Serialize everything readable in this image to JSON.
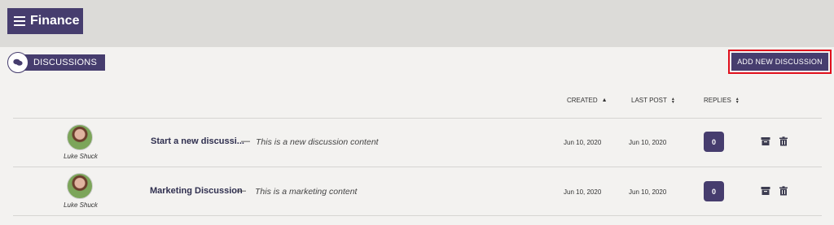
{
  "header": {
    "title": "Finance"
  },
  "section": {
    "title": "DISCUSSIONS",
    "add_button": "ADD NEW DISCUSSION"
  },
  "table": {
    "columns": [
      "CREATED",
      "LAST POST",
      "REPLIES"
    ],
    "rows": [
      {
        "author": "Luke Shuck",
        "title": "Start a new discussi...",
        "separator": "—",
        "excerpt": "This is a new discussion content",
        "created": "Jun 10, 2020",
        "last_post": "Jun 10, 2020",
        "replies": "0"
      },
      {
        "author": "Luke Shuck",
        "title": "Marketing Discussion",
        "separator": "—",
        "excerpt": "This is a marketing content",
        "created": "Jun 10, 2020",
        "last_post": "Jun 10, 2020",
        "replies": "0"
      }
    ]
  },
  "colors": {
    "accent": "#463d6e",
    "highlight": "#e0101d",
    "background": "#dcdbd8",
    "panel": "#f3f2f0"
  },
  "icons": {
    "menu": "hamburger-icon",
    "discussion": "chat-bubble-icon",
    "archive": "archive-icon",
    "delete": "trash-icon"
  }
}
